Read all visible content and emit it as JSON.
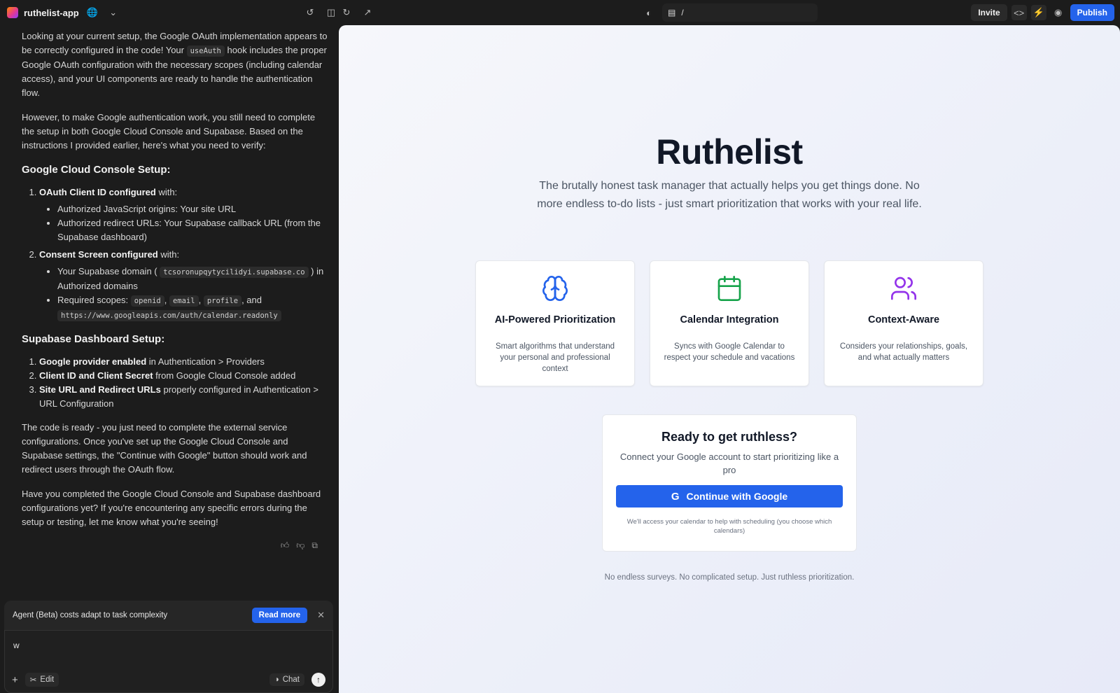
{
  "topbar": {
    "project_name": "ruthelist-app",
    "url_path": "/",
    "invite_label": "Invite",
    "publish_label": "Publish"
  },
  "chat": {
    "intro_1": "Looking at your current setup, the Google OAuth implementation appears to be correctly configured in the code! Your",
    "intro_code": "useAuth",
    "intro_2": "hook includes the proper Google OAuth configuration with the necessary scopes (including calendar access), and your UI components are ready to handle the authentication flow.",
    "para2": "However, to make Google authentication work, you still need to complete the setup in both Google Cloud Console and Supabase. Based on the instructions I provided earlier, here's what you need to verify:",
    "heading_gcc": "Google Cloud Console Setup:",
    "gcc_1_bold": "OAuth Client ID configured",
    "gcc_1_rest": " with:",
    "gcc_1_a": "Authorized JavaScript origins: Your site URL",
    "gcc_1_b": "Authorized redirect URLs: Your Supabase callback URL (from the Supabase dashboard)",
    "gcc_2_bold": "Consent Screen configured",
    "gcc_2_rest": " with:",
    "gcc_2_a_pre": "Your Supabase domain (",
    "gcc_2_a_code": "tcsoronupqytycilidyi.supabase.co",
    "gcc_2_a_post": ") in Authorized domains",
    "gcc_2_b_pre": "Required scopes:",
    "scope_1": "openid",
    "scope_2": "email",
    "scope_3": "profile",
    "scope_and": ", and",
    "scope_4": "https://www.googleapis.com/auth/calendar.readonly",
    "heading_sb": "Supabase Dashboard Setup:",
    "sb_1_bold": "Google provider enabled",
    "sb_1_rest": " in Authentication > Providers",
    "sb_2_bold": "Client ID and Client Secret",
    "sb_2_rest": " from Google Cloud Console added",
    "sb_3_bold": "Site URL and Redirect URLs",
    "sb_3_rest": " properly configured in Authentication > URL Configuration",
    "para3": "The code is ready - you just need to complete the external service configurations. Once you've set up the Google Cloud Console and Supabase settings, the \"Continue with Google\" button should work and redirect users through the OAuth flow.",
    "para4": "Have you completed the Google Cloud Console and Supabase dashboard configurations yet? If you're encountering any specific errors during the setup or testing, let me know what you're seeing!",
    "notice_text": "Agent (Beta) costs adapt to task complexity",
    "read_more_label": "Read more",
    "input_value": "w",
    "edit_label": "Edit",
    "chat_label": "Chat"
  },
  "preview": {
    "title": "Ruthelist",
    "subtitle": "The brutally honest task manager that actually helps you get things done. No more endless to-do lists - just smart prioritization that works with your real life.",
    "features": [
      {
        "title": "AI-Powered Prioritization",
        "desc": "Smart algorithms that understand your personal and professional context",
        "icon": "brain-icon",
        "color": "#2463eb"
      },
      {
        "title": "Calendar Integration",
        "desc": "Syncs with Google Calendar to respect your schedule and vacations",
        "icon": "calendar-icon",
        "color": "#16a34a"
      },
      {
        "title": "Context-Aware",
        "desc": "Considers your relationships, goals, and what actually matters",
        "icon": "users-icon",
        "color": "#9333ea"
      }
    ],
    "cta_title": "Ready to get ruthless?",
    "cta_sub": "Connect your Google account to start prioritizing like a pro",
    "google_button_label": "Continue with Google",
    "cta_note": "We'll access your calendar to help with scheduling (you choose which calendars)",
    "footer_text": "No endless surveys. No complicated setup. Just ruthless prioritization."
  }
}
